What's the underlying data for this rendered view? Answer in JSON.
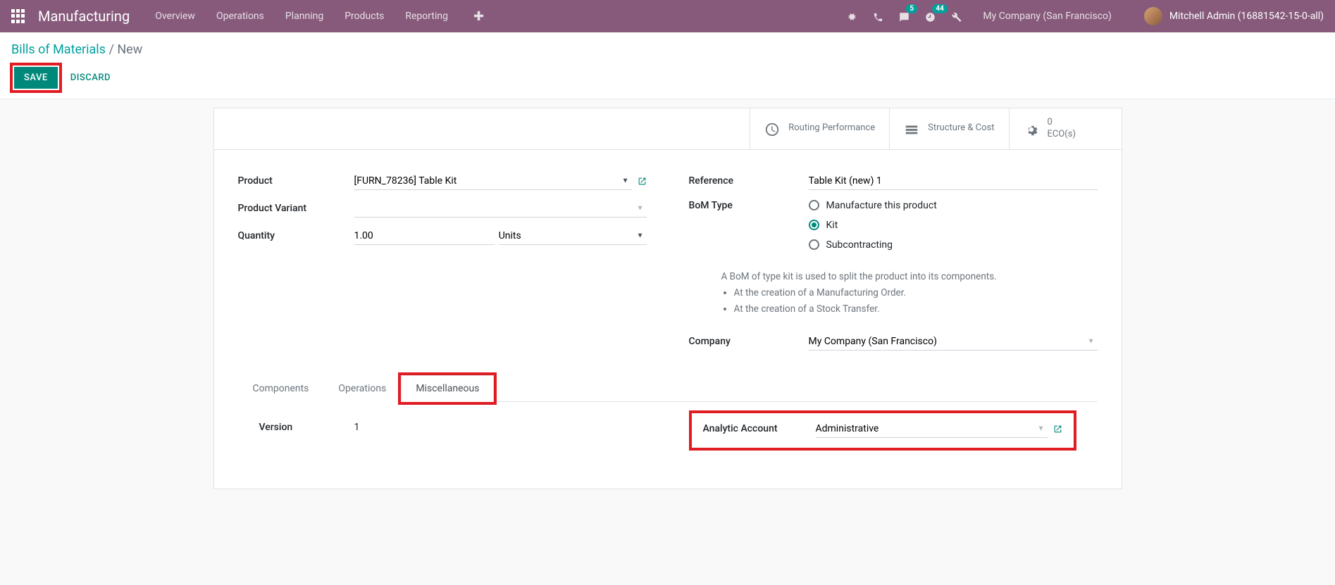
{
  "topbar": {
    "app": "Manufacturing",
    "nav": [
      "Overview",
      "Operations",
      "Planning",
      "Products",
      "Reporting"
    ],
    "messaging_badge": "5",
    "activities_badge": "44",
    "company": "My Company (San Francisco)",
    "user": "Mitchell Admin (16881542-15-0-all)"
  },
  "breadcrumb": {
    "root": "Bills of Materials",
    "current": "New"
  },
  "actions": {
    "save": "SAVE",
    "discard": "DISCARD"
  },
  "stat_buttons": {
    "routing": "Routing Performance",
    "structure": "Structure & Cost",
    "eco_count": "0",
    "eco_label": "ECO(s)"
  },
  "form": {
    "labels": {
      "product": "Product",
      "variant": "Product Variant",
      "quantity": "Quantity",
      "reference": "Reference",
      "bom_type": "BoM Type",
      "company": "Company"
    },
    "product": "[FURN_78236] Table Kit",
    "variant": "",
    "quantity": "1.00",
    "uom": "Units",
    "reference": "Table Kit (new) 1",
    "bom_type": {
      "manufacture": "Manufacture this product",
      "kit": "Kit",
      "subcontract": "Subcontracting",
      "selected": "kit"
    },
    "help": {
      "intro": "A BoM of type kit is used to split the product into its components.",
      "b1": "At the creation of a Manufacturing Order.",
      "b2": "At the creation of a Stock Transfer."
    },
    "company": "My Company (San Francisco)"
  },
  "tabs": {
    "components": "Components",
    "operations": "Operations",
    "misc": "Miscellaneous"
  },
  "misc": {
    "version_label": "Version",
    "version_value": "1",
    "analytic_label": "Analytic Account",
    "analytic_value": "Administrative"
  }
}
